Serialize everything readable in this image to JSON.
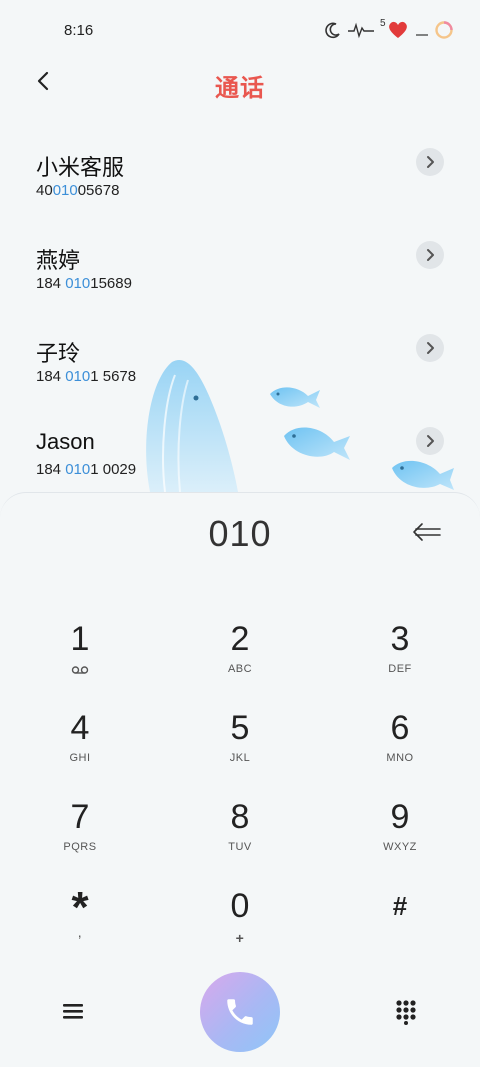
{
  "status_bar": {
    "time": "8:16",
    "badge_count": "5"
  },
  "header": {
    "title": "通话"
  },
  "contacts": [
    {
      "name": "小米客服",
      "number_pre": "40",
      "number_hl": "010",
      "number_post": "05678"
    },
    {
      "name": "燕婷",
      "number_pre": "184 ",
      "number_hl": "010",
      "number_post": "15689"
    },
    {
      "name": "子玲",
      "number_pre": "184 ",
      "number_hl": "010",
      "number_post": "1 5678"
    },
    {
      "name": "Jason",
      "number_pre": "184 ",
      "number_hl": "010",
      "number_post": "1 0029"
    }
  ],
  "dialer": {
    "input": "010"
  },
  "keys": [
    {
      "digit": "1",
      "letters": ""
    },
    {
      "digit": "2",
      "letters": "ABC"
    },
    {
      "digit": "3",
      "letters": "DEF"
    },
    {
      "digit": "4",
      "letters": "GHI"
    },
    {
      "digit": "5",
      "letters": "JKL"
    },
    {
      "digit": "6",
      "letters": "MNO"
    },
    {
      "digit": "7",
      "letters": "PQRS"
    },
    {
      "digit": "8",
      "letters": "TUV"
    },
    {
      "digit": "9",
      "letters": "WXYZ"
    },
    {
      "digit": "*",
      "letters": ","
    },
    {
      "digit": "0",
      "letters": "+"
    },
    {
      "digit": "#",
      "letters": ""
    }
  ],
  "icons": {
    "back": "chevron-left-icon",
    "detail": "chevron-right-icon",
    "backspace": "backspace-arrow-icon",
    "voicemail": "voicemail-icon",
    "menu": "menu-icon",
    "call": "phone-icon",
    "keypad": "dialpad-icon"
  },
  "colors": {
    "title": "#e9574f",
    "match_highlight": "#3c8fd8",
    "call_gradient_start": "#d9a8ec",
    "call_gradient_end": "#8fc6f7"
  }
}
